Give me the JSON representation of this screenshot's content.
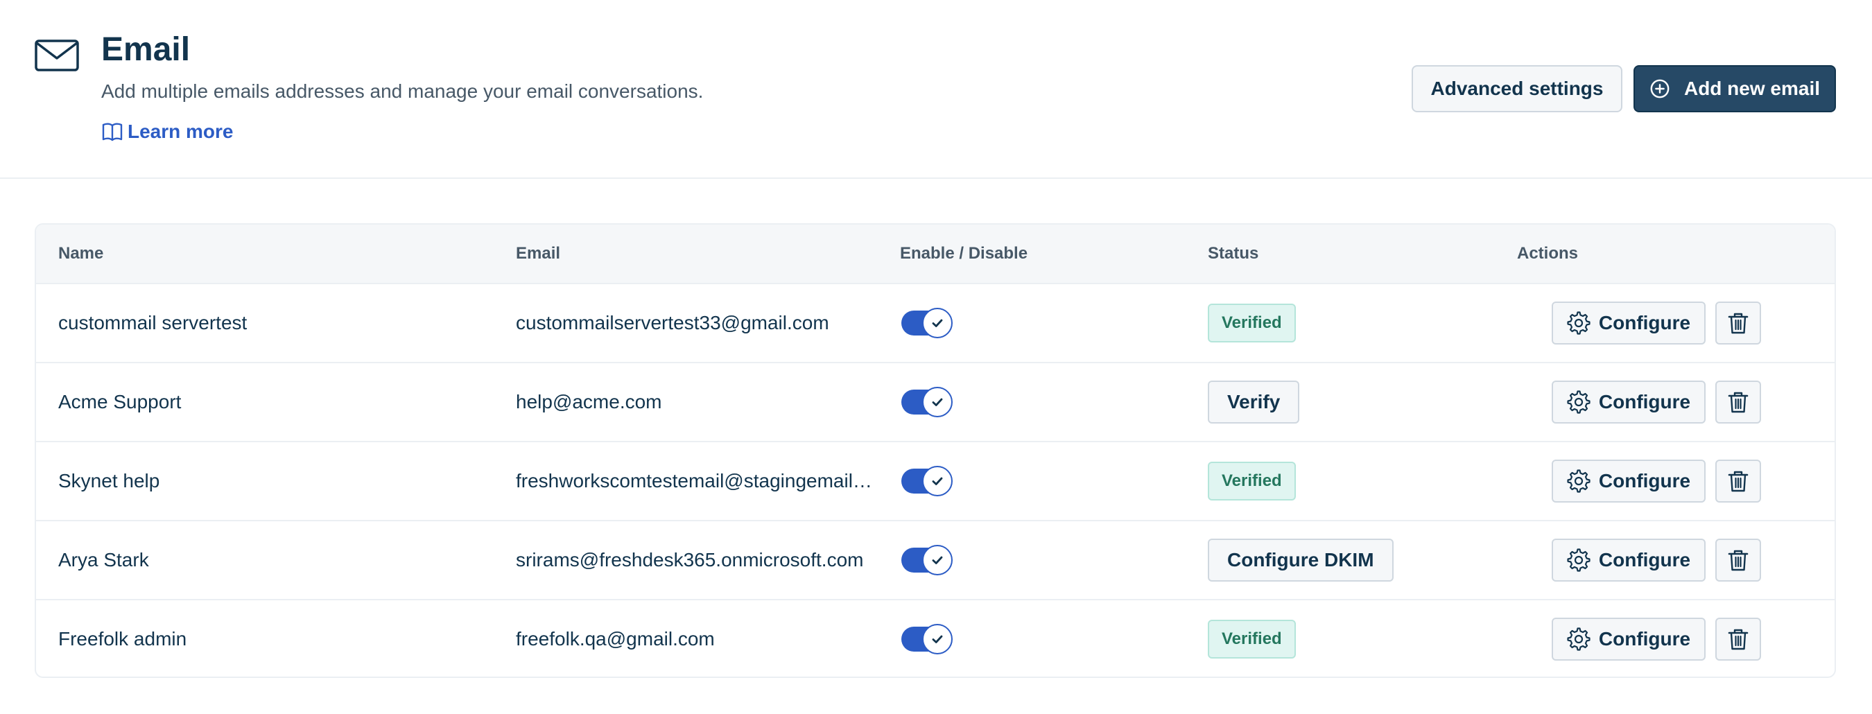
{
  "header": {
    "title": "Email",
    "subtitle": "Add multiple emails addresses and manage your email conversations.",
    "learn_more": "Learn more",
    "advanced_settings": "Advanced settings",
    "add_new_email": "Add new email"
  },
  "table": {
    "columns": {
      "name": "Name",
      "email": "Email",
      "toggle": "Enable / Disable",
      "status": "Status",
      "actions": "Actions"
    },
    "configure_label": "Configure",
    "rows": [
      {
        "name": "custommail servertest",
        "email": "custommailservertest33@gmail.com",
        "enabled": true,
        "status": "Verified",
        "status_type": "badge"
      },
      {
        "name": "Acme Support",
        "email": "help@acme.com",
        "enabled": true,
        "status": "Verify",
        "status_type": "button"
      },
      {
        "name": "Skynet help",
        "email": "freshworkscomtestemail@stagingemail…",
        "enabled": true,
        "status": "Verified",
        "status_type": "badge"
      },
      {
        "name": "Arya Stark",
        "email": "srirams@freshdesk365.onmicrosoft.com",
        "enabled": true,
        "status": "Configure DKIM",
        "status_type": "button"
      },
      {
        "name": "Freefolk admin",
        "email": "freefolk.qa@gmail.com",
        "enabled": true,
        "status": "Verified",
        "status_type": "badge"
      }
    ]
  },
  "icons": {
    "header": "mail-icon",
    "learn_more": "book-icon",
    "add": "plus-circle-icon",
    "configure": "gear-icon",
    "delete": "trash-icon",
    "toggle": "check-icon"
  },
  "colors": {
    "primary": "#264966",
    "link": "#2c5cc5",
    "toggle_on": "#2c5cc5",
    "verified_bg": "#e0f5f1",
    "verified_text": "#24775e"
  }
}
